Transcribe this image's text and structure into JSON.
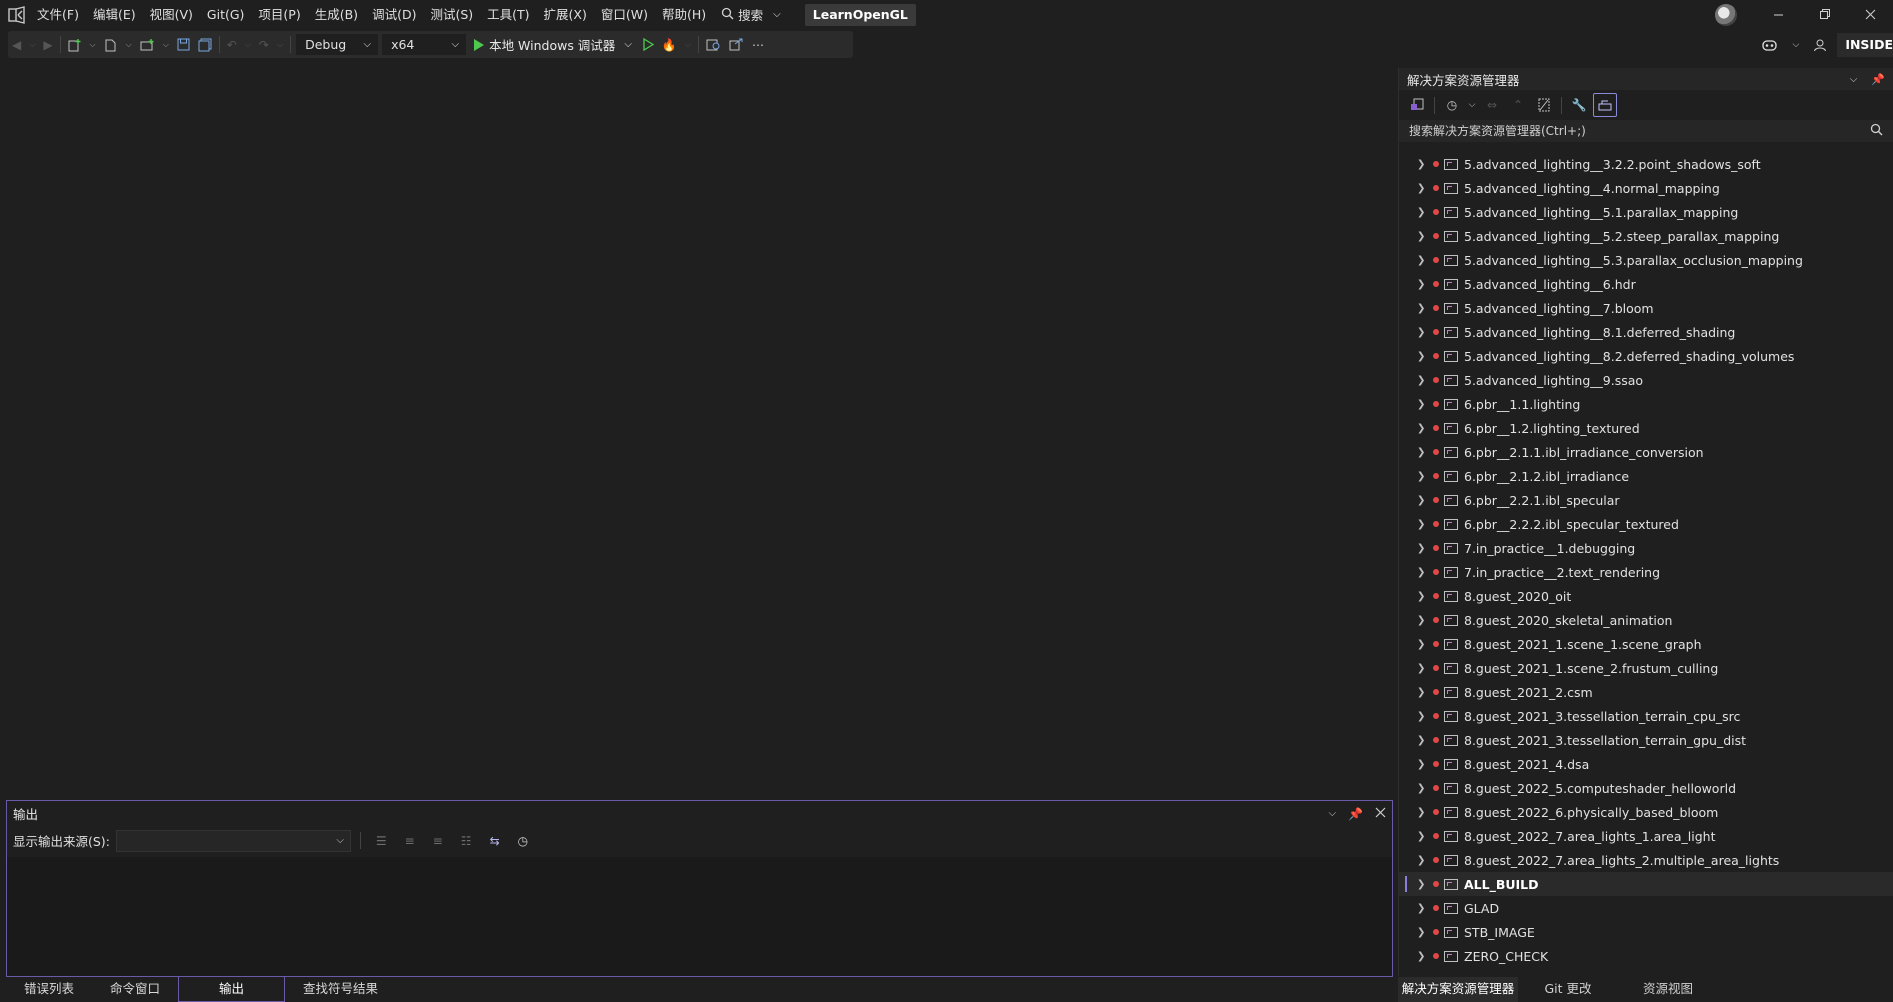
{
  "menu": {
    "items": [
      "文件(F)",
      "编辑(E)",
      "视图(V)",
      "Git(G)",
      "项目(P)",
      "生成(B)",
      "调试(D)",
      "测试(S)",
      "工具(T)",
      "扩展(X)",
      "窗口(W)",
      "帮助(H)"
    ],
    "search_label": "搜索",
    "solution_name": "LearnOpenGL"
  },
  "toolbar": {
    "configuration": "Debug",
    "platform": "x64",
    "run_label": "本地 Windows 调试器",
    "insiders_label": "INSIDE"
  },
  "output": {
    "title": "输出",
    "source_label": "显示输出来源(S):",
    "source_value": ""
  },
  "bottom_tabs": [
    {
      "label": "错误列表",
      "active": false
    },
    {
      "label": "命令窗口",
      "active": false
    },
    {
      "label": "输出",
      "active": true
    },
    {
      "label": "查找符号结果",
      "active": false
    }
  ],
  "solution_explorer": {
    "title": "解决方案资源管理器",
    "search_placeholder": "搜索解决方案资源管理器(Ctrl+;)",
    "items": [
      {
        "label": "5.advanced_lighting__3.2.2.point_shadows_soft"
      },
      {
        "label": "5.advanced_lighting__4.normal_mapping"
      },
      {
        "label": "5.advanced_lighting__5.1.parallax_mapping"
      },
      {
        "label": "5.advanced_lighting__5.2.steep_parallax_mapping"
      },
      {
        "label": "5.advanced_lighting__5.3.parallax_occlusion_mapping"
      },
      {
        "label": "5.advanced_lighting__6.hdr"
      },
      {
        "label": "5.advanced_lighting__7.bloom"
      },
      {
        "label": "5.advanced_lighting__8.1.deferred_shading"
      },
      {
        "label": "5.advanced_lighting__8.2.deferred_shading_volumes"
      },
      {
        "label": "5.advanced_lighting__9.ssao"
      },
      {
        "label": "6.pbr__1.1.lighting"
      },
      {
        "label": "6.pbr__1.2.lighting_textured"
      },
      {
        "label": "6.pbr__2.1.1.ibl_irradiance_conversion"
      },
      {
        "label": "6.pbr__2.1.2.ibl_irradiance"
      },
      {
        "label": "6.pbr__2.2.1.ibl_specular"
      },
      {
        "label": "6.pbr__2.2.2.ibl_specular_textured"
      },
      {
        "label": "7.in_practice__1.debugging"
      },
      {
        "label": "7.in_practice__2.text_rendering"
      },
      {
        "label": "8.guest_2020_oit"
      },
      {
        "label": "8.guest_2020_skeletal_animation"
      },
      {
        "label": "8.guest_2021_1.scene_1.scene_graph"
      },
      {
        "label": "8.guest_2021_1.scene_2.frustum_culling"
      },
      {
        "label": "8.guest_2021_2.csm"
      },
      {
        "label": "8.guest_2021_3.tessellation_terrain_cpu_src"
      },
      {
        "label": "8.guest_2021_3.tessellation_terrain_gpu_dist"
      },
      {
        "label": "8.guest_2021_4.dsa"
      },
      {
        "label": "8.guest_2022_5.computeshader_helloworld"
      },
      {
        "label": "8.guest_2022_6.physically_based_bloom"
      },
      {
        "label": "8.guest_2022_7.area_lights_1.area_light"
      },
      {
        "label": "8.guest_2022_7.area_lights_2.multiple_area_lights"
      },
      {
        "label": "ALL_BUILD",
        "bold": true,
        "selected": true
      },
      {
        "label": "GLAD"
      },
      {
        "label": "STB_IMAGE"
      },
      {
        "label": "ZERO_CHECK"
      }
    ],
    "tabs": [
      {
        "label": "解决方案资源管理器",
        "active": true
      },
      {
        "label": "Git 更改",
        "active": false
      },
      {
        "label": "资源视图",
        "active": false
      }
    ]
  },
  "colors": {
    "accent": "#6b5aa8",
    "run_green": "#4ec94e",
    "error_red": "#e04848"
  }
}
